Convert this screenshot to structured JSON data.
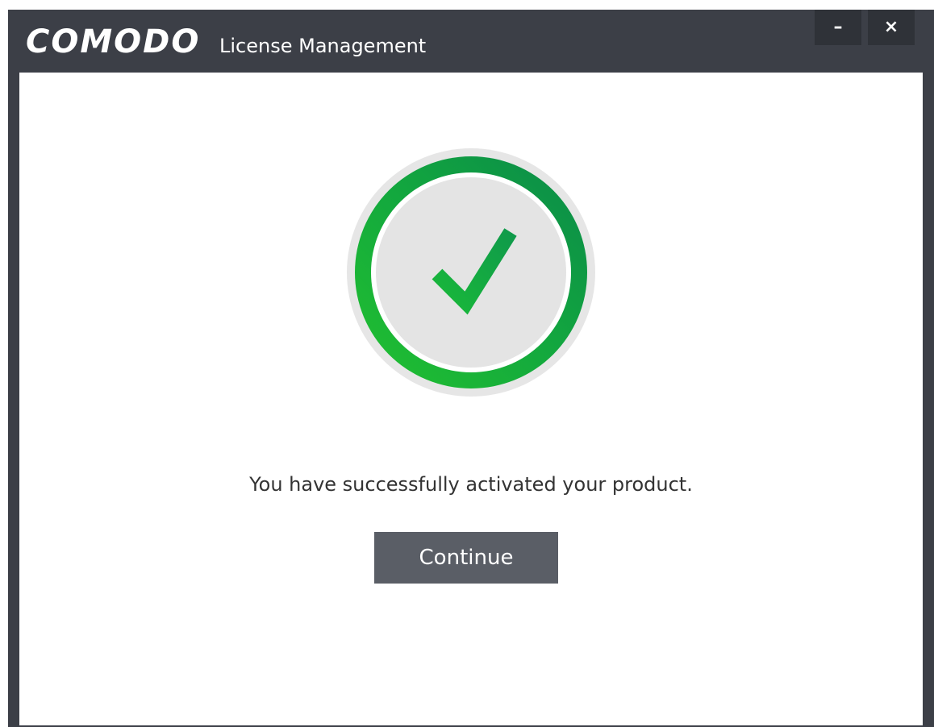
{
  "window": {
    "brand": "COMODO",
    "title": "License Management",
    "controls": {
      "minimize_label": "–",
      "close_label": "×"
    }
  },
  "main": {
    "status_icon": "checkmark-success-icon",
    "message": "You have successfully activated your product.",
    "continue_label": "Continue"
  },
  "colors": {
    "titlebar": "#3c3f47",
    "success_green": "#1db83a",
    "button": "#5a5e66"
  }
}
